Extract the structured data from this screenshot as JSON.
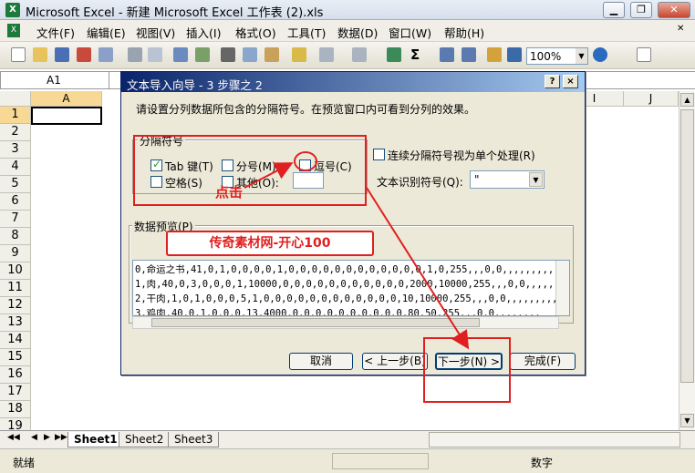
{
  "app": {
    "title": "Microsoft Excel - 新建 Microsoft Excel 工作表 (2).xls",
    "icon": "excel-icon"
  },
  "menu": [
    "文件(F)",
    "编辑(E)",
    "视图(V)",
    "插入(I)",
    "格式(O)",
    "工具(T)",
    "数据(D)",
    "窗口(W)",
    "帮助(H)"
  ],
  "toolbar": {
    "zoom": "100%"
  },
  "namebox": {
    "value": "A1"
  },
  "grid": {
    "col_left": "A",
    "col_i": "I",
    "col_j": "J",
    "rows": [
      "1",
      "2",
      "3",
      "4",
      "5",
      "6",
      "7",
      "8",
      "9",
      "10",
      "11",
      "12",
      "13",
      "14",
      "15",
      "16",
      "17",
      "18",
      "19"
    ]
  },
  "sheets": [
    "Sheet1",
    "Sheet2",
    "Sheet3"
  ],
  "status": {
    "left": "就绪",
    "right": "数字"
  },
  "dialog": {
    "title": "文本导入向导 - 3 步骤之 2",
    "help_btn": "?",
    "close_btn": "×",
    "instruction": "请设置分列数据所包含的分隔符号。在预览窗口内可看到分列的效果。",
    "delimiters_label": "分隔符号",
    "tab_label": "Tab 键(T)",
    "semicolon_label": "分号(M)",
    "comma_label": "逗号(C)",
    "space_label": "空格(S)",
    "other_label": "其他(O):",
    "consecutive_label": "连续分隔符号视为单个处理(R)",
    "qualifier_label": "文本识别符号(Q):",
    "qualifier_value": "\"",
    "preview_label": "数据预览(P)",
    "preview_lines": [
      "0,命运之书,41,0,1,0,0,0,0,1,0,0,0,0,0,0,0,0,0,0,0,0,1,0,255,,,0,0,,,,,,,,,,,",
      "1,肉,40,0,3,0,0,0,1,10000,0,0,0,0,0,0,0,0,0,0,0,2000,10000,255,,,0,0,,,,,",
      "2,干肉,1,0,1,0,0,0,5,1,0,0,0,0,0,0,0,0,0,0,0,0,10,10000,255,,,0,0,,,,,,,,,",
      "3,鸡肉,40,0,1,0,0,0,13,4000,0,0,0,0,0,0,0,0,0,0,80,50,255,,,0,0,,,,,,,,"
    ],
    "buttons": {
      "cancel": "取消",
      "back": "< 上一步(B)",
      "next": "下一步(N) >",
      "finish": "完成(F)"
    },
    "tab_checked": true
  },
  "annotations": {
    "click_text": "点击",
    "watermark": "传奇素材网-开心100",
    "color": "#e02020"
  }
}
